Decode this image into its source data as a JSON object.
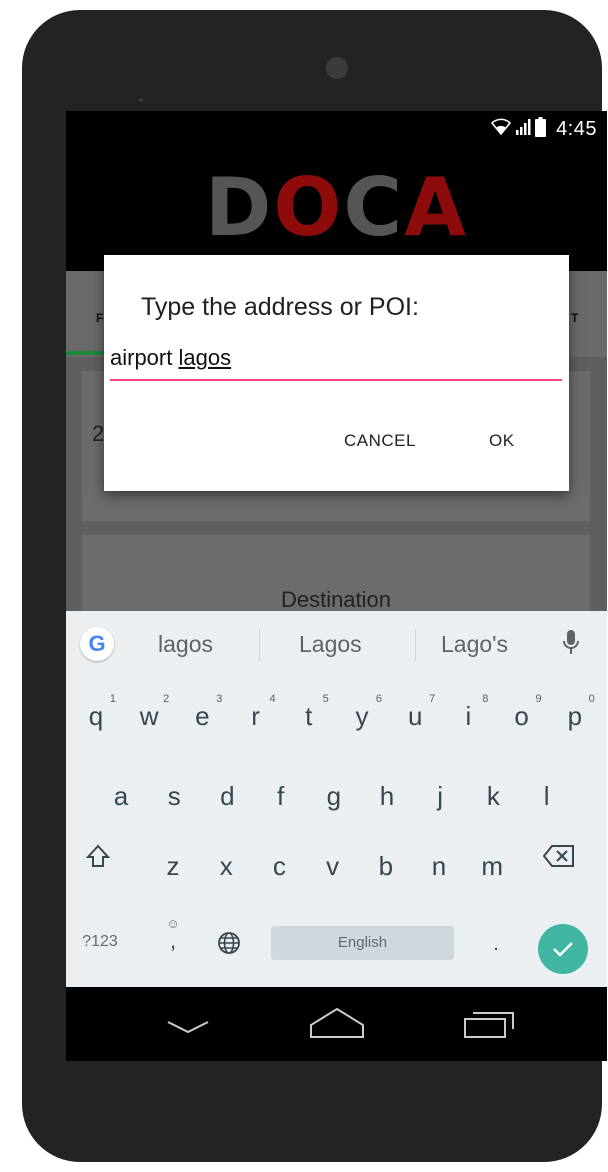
{
  "status": {
    "time": "4:45"
  },
  "app": {
    "logo": [
      "D",
      "O",
      "C",
      "A"
    ],
    "tab_left_fragment": "F",
    "tab_right_fragment": "T",
    "card1_text": "2",
    "destination_label": "Destination"
  },
  "dialog": {
    "title": "Type the address or POI:",
    "input_prefix": "airport ",
    "input_word": "lagos",
    "cancel_label": "CANCEL",
    "ok_label": "OK",
    "accent_color": "#ff4081"
  },
  "keyboard": {
    "suggestions": [
      "lagos",
      "Lagos",
      "Lago's"
    ],
    "row1": [
      {
        "k": "q",
        "h": "1"
      },
      {
        "k": "w",
        "h": "2"
      },
      {
        "k": "e",
        "h": "3"
      },
      {
        "k": "r",
        "h": "4"
      },
      {
        "k": "t",
        "h": "5"
      },
      {
        "k": "y",
        "h": "6"
      },
      {
        "k": "u",
        "h": "7"
      },
      {
        "k": "i",
        "h": "8"
      },
      {
        "k": "o",
        "h": "9"
      },
      {
        "k": "p",
        "h": "0"
      }
    ],
    "row2": [
      "a",
      "s",
      "d",
      "f",
      "g",
      "h",
      "j",
      "k",
      "l"
    ],
    "row3": [
      "z",
      "x",
      "c",
      "v",
      "b",
      "n",
      "m"
    ],
    "symbols_label": "?123",
    "comma_label": ",",
    "period_label": ".",
    "space_label": "English",
    "enter_color": "#3fb5a2"
  }
}
